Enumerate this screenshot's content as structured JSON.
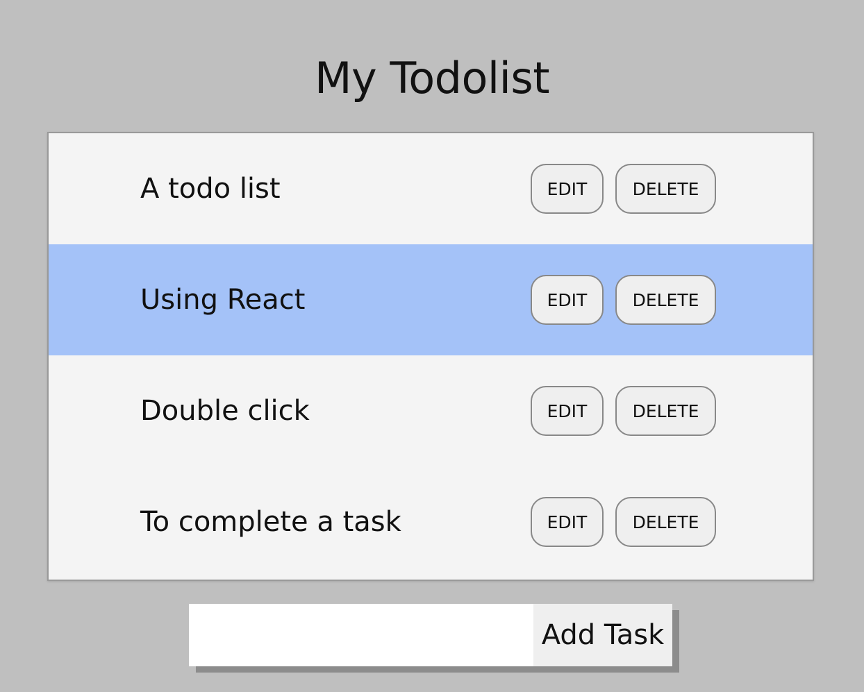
{
  "header": {
    "title": "My Todolist"
  },
  "tasks": [
    {
      "label": "A todo list",
      "edit_label": "EDIT",
      "delete_label": "DELETE",
      "selected": false
    },
    {
      "label": "Using React",
      "edit_label": "EDIT",
      "delete_label": "DELETE",
      "selected": true
    },
    {
      "label": "Double click",
      "edit_label": "EDIT",
      "delete_label": "DELETE",
      "selected": false
    },
    {
      "label": "To complete a task",
      "edit_label": "EDIT",
      "delete_label": "DELETE",
      "selected": false
    }
  ],
  "add_form": {
    "input_value": "",
    "input_placeholder": "",
    "button_label": "Add Task"
  },
  "colors": {
    "background": "#bfbfbf",
    "list_background": "#f4f4f4",
    "selected_row": "#a4c2f8",
    "button_background": "#efefef"
  }
}
